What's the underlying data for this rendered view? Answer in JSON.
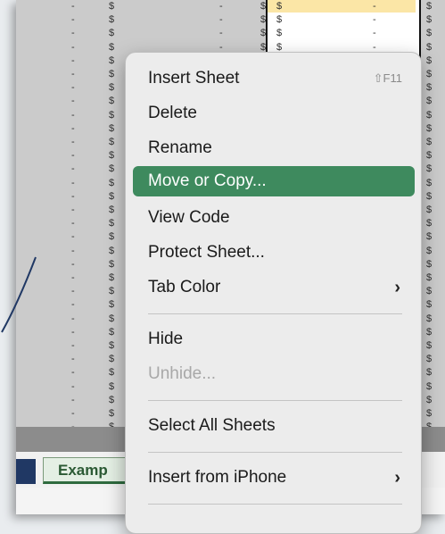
{
  "spreadsheet": {
    "currency_symbol": "$",
    "dash": "-",
    "tab_label": "Examp"
  },
  "context_menu": {
    "items": [
      {
        "label": "Insert Sheet",
        "shortcut": "⇧F11"
      },
      {
        "label": "Delete"
      },
      {
        "label": "Rename"
      },
      {
        "label": "Move or Copy...",
        "state": "selected"
      },
      {
        "label": "View Code"
      },
      {
        "label": "Protect Sheet..."
      },
      {
        "label": "Tab Color",
        "submenu": true
      },
      {
        "label": "Hide"
      },
      {
        "label": "Unhide...",
        "state": "disabled"
      },
      {
        "label": "Select All Sheets"
      },
      {
        "label": "Insert from iPhone",
        "submenu": true
      }
    ],
    "submenu_glyph": "›"
  },
  "colors": {
    "selection": "#3e8a5e",
    "sheet_tab_text": "#2b5a34",
    "highlight_cell": "#fbe6a6"
  }
}
